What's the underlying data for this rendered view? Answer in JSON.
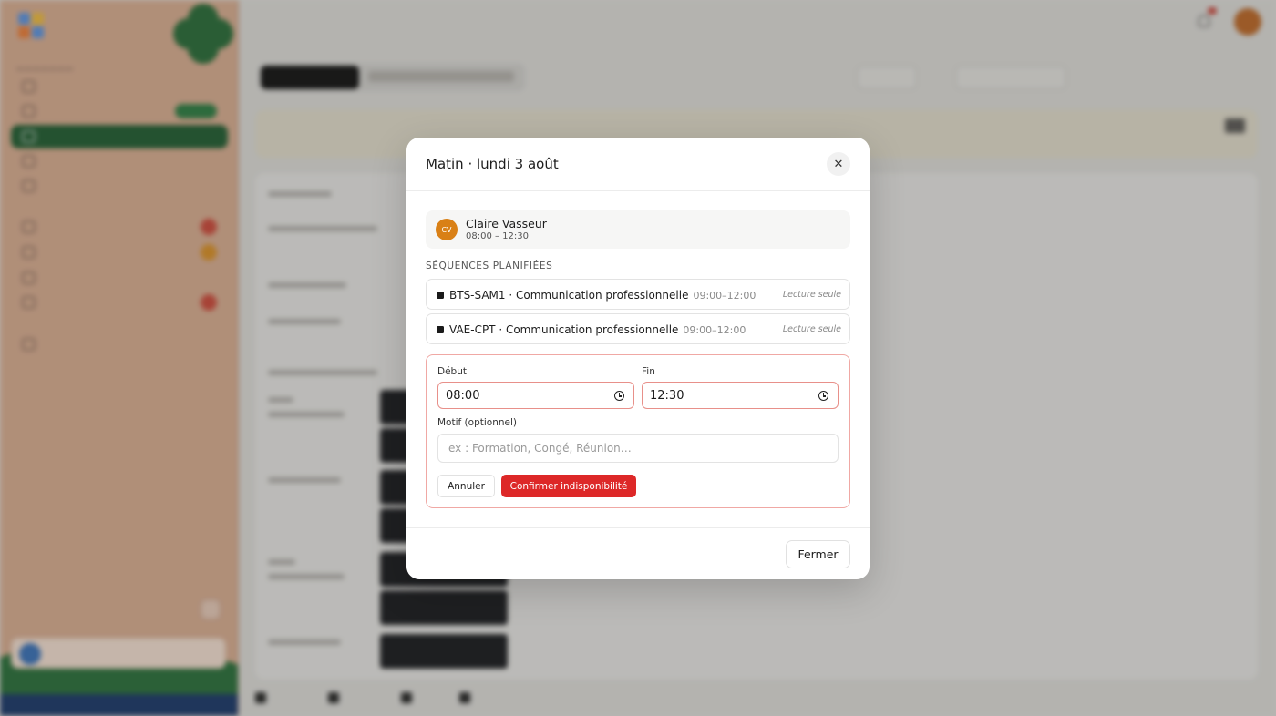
{
  "modal": {
    "title": "Matin · lundi 3 août",
    "close_icon": "close-icon",
    "person": {
      "initials": "CV",
      "name": "Claire Vasseur",
      "time": "08:00 – 12:30"
    },
    "sequences_label": "SÉQUENCES PLANIFIÉES",
    "sequences": [
      {
        "title": "BTS-SAM1 · Communication professionnelle",
        "time": "09:00–12:00",
        "status": "Lecture seule"
      },
      {
        "title": "VAE-CPT · Communication professionnelle",
        "time": "09:00–12:00",
        "status": "Lecture seule"
      }
    ],
    "form": {
      "start_label": "Début",
      "start_value": "08:00",
      "end_label": "Fin",
      "end_value": "12:30",
      "reason_label": "Motif (optionnel)",
      "reason_value": "",
      "reason_placeholder": "ex : Formation, Congé, Réunion…",
      "cancel_label": "Annuler",
      "confirm_label": "Confirmer indisponibilité"
    },
    "footer_close_label": "Fermer"
  },
  "colors": {
    "accent_red": "#dd2828",
    "avatar_orange": "#d98016",
    "sidebar_active": "#245c34"
  }
}
